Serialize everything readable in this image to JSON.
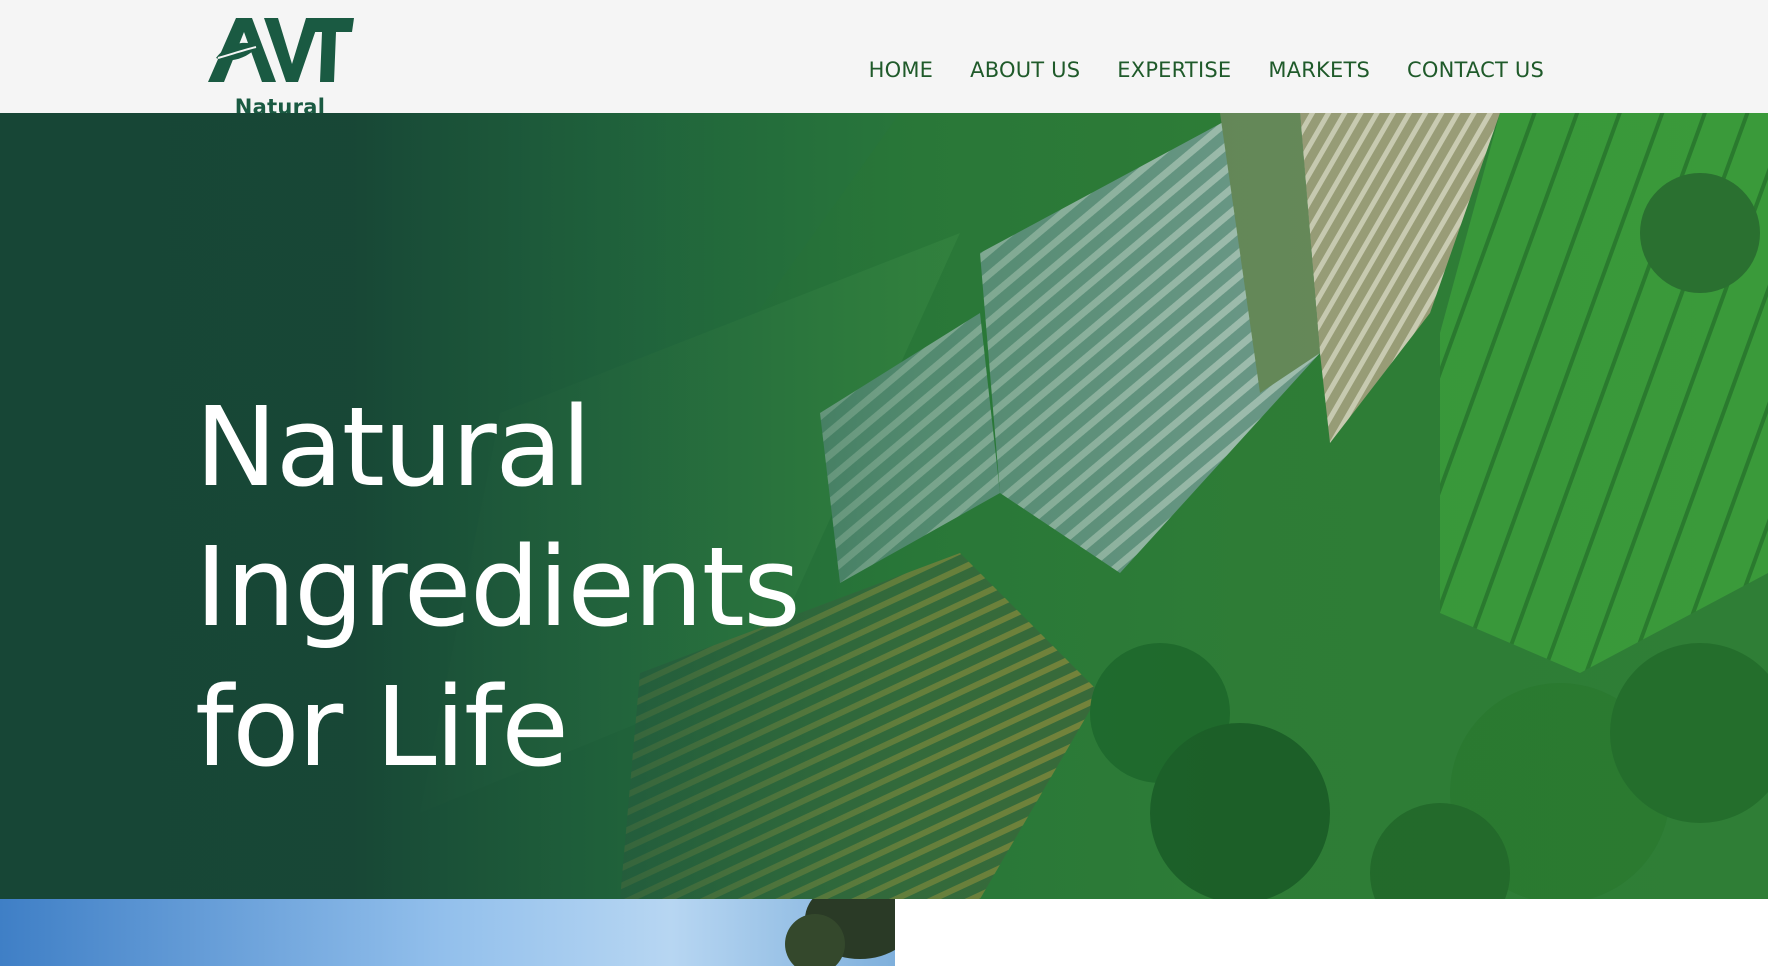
{
  "brand": {
    "logo_letters": "AVT",
    "logo_word": "Natural",
    "color": "#1a5a42"
  },
  "nav": {
    "items": [
      {
        "label": "HOME"
      },
      {
        "label": "ABOUT US"
      },
      {
        "label": "EXPERTISE"
      },
      {
        "label": "MARKETS"
      },
      {
        "label": "CONTACT US"
      }
    ],
    "color": "#1f5a2a"
  },
  "hero": {
    "title_lines": [
      "Natural",
      "Ingredients",
      "for Life"
    ],
    "overlay_color": "#1a4a38",
    "background_image": "aerial-farmland-image"
  },
  "bottom": {
    "left_image": "sky-and-trees-image"
  }
}
